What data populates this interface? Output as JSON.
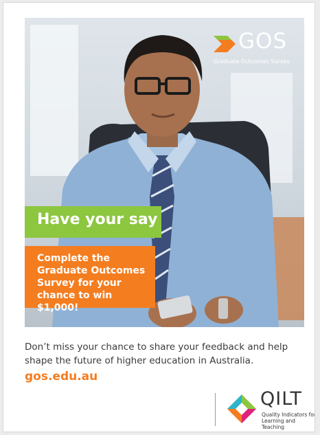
{
  "brand": {
    "name": "GOS",
    "subtitle": "Graduate Outcomes Survey",
    "accent_orange": "#f47d20",
    "accent_green": "#8dc63f"
  },
  "headline": "Have your say",
  "promo": "Complete the\nGraduate Outcomes\nSurvey for your\nchance to win $1,000!",
  "description": "Don’t miss your chance to share your feedback and help shape the future of higher education in Australia.",
  "url": "gos.edu.au",
  "partner": {
    "name": "QILT",
    "subtitle": "Quality Indicators for\nLearning and Teaching"
  }
}
